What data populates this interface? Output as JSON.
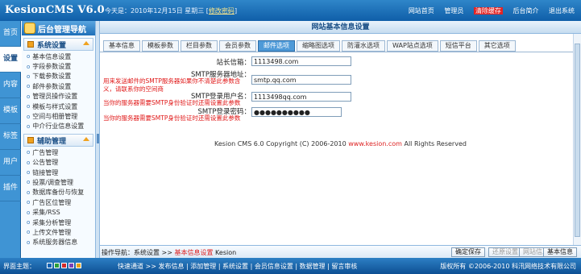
{
  "header": {
    "logo": "KesionCMS V6.0",
    "info_text": "今天是：2010年12月15日 星期三 [",
    "info_link": "修改密码",
    "info_close": "]",
    "links": [
      "网站首页",
      "管理员",
      "清除缓存",
      "后台简介",
      "退出系统"
    ]
  },
  "left_tabs": [
    {
      "label": "首页"
    },
    {
      "label": "设置"
    },
    {
      "label": "内容"
    },
    {
      "label": "模板"
    },
    {
      "label": "标签"
    },
    {
      "label": "用户"
    },
    {
      "label": "插件"
    }
  ],
  "sidebar": {
    "title": "后台管理导航",
    "groups": [
      {
        "title": "系统设置",
        "items": [
          "基本信息设置",
          "字段参数设置",
          "下载参数设置",
          "邮件参数设置",
          "管理员操作设置",
          "模板与样式设置",
          "空间与相册管理",
          "中介行业信息设置"
        ]
      },
      {
        "title": "辅助管理",
        "items": [
          "广告管理",
          "公告管理",
          "链接管理",
          "投票/调查管理",
          "数据库备份与恢复",
          "广告区位管理",
          "采集/RSS",
          "采集分析管理",
          "上传文件管理",
          "系统服务器信息"
        ]
      }
    ]
  },
  "main": {
    "title": "网站基本信息设置",
    "tabs": [
      "基本信息",
      "模板参数",
      "栏目参数",
      "会员参数",
      "邮件选项",
      "缩略图选项",
      "防灌水选项",
      "WAP站点选项",
      "短信平台",
      "其它选项"
    ],
    "active_tab_index": 4,
    "form": {
      "row1_label": "站长信箱：",
      "row1_value": "1113498.com",
      "row2_label": "SMTP服务器地址：",
      "row2_hint": "用来发送邮件的SMTP服务器如果你不清楚此参数含义，请联系你的空间商",
      "row2_value": "smtp.qq.com",
      "row3_label": "SMTP登录用户名：",
      "row3_hint": "当你的服务器需要SMTP身份验证时还需设置此参数",
      "row3_value": "1113498qq.com",
      "row4_label": "SMTP登录密码：",
      "row4_hint": "当你的服务器需要SMTP身份验证时还需设置此参数",
      "row4_value": "●●●●●●●●●●"
    },
    "copyright_pre": "Kesion CMS 6.0 Copyright (C) 2006-2010",
    "copyright_link": "www.kesion.com",
    "copyright_post": "All Rights Reserved"
  },
  "statusbar": {
    "crumb_prefix": "操作导航：系统设置 >>",
    "crumb_current": "基本信息设置",
    "crumb_suffix": "Kesion",
    "buttons": [
      "确定保存",
      "还原设置",
      "网站信息",
      "基本信息"
    ]
  },
  "footer": {
    "left": "界面主题：",
    "swatch_colors": [
      "#0f62b5",
      "#2a9d3a",
      "#d12a2a",
      "#7b3fb5",
      "#e4a21a"
    ],
    "mid": "快速通道 >> 发布信息 | 添加管理 | 系统设置 | 会员信息设置 | 数据管理 | 留言审核",
    "right": "版权所有 ©2006-2010 科汛网络技术有限公司"
  },
  "colors": {
    "accent": "#2f86c9",
    "active_tab": "#4e9ad8",
    "hint_red": "#e01818"
  }
}
